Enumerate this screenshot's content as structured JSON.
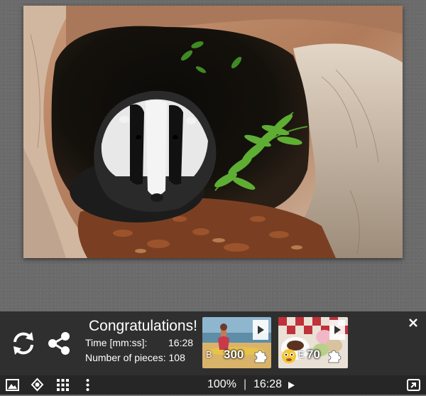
{
  "congrats": {
    "title": "Congratulations!",
    "time_label": "Time [mm:ss]:",
    "time_value": "16:28",
    "pieces_label": "Number of pieces: 108"
  },
  "next_puzzles": [
    {
      "letter": "B",
      "pieces": "300",
      "thumb_icon": "beach-woman-thumbnail"
    },
    {
      "letter": "E",
      "pieces": "70",
      "thumb_icon": "coffee-macarons-thumbnail"
    }
  ],
  "toolbar": {
    "zoom": "100%",
    "divider": "|",
    "timer": "16:28"
  },
  "icons": {
    "restart": "restart-icon",
    "share": "share-icon",
    "close": "close-icon",
    "image": "image-icon",
    "ghost": "ghost-image-icon",
    "grid": "grid-icon",
    "more": "more-vert-icon",
    "play": "play-icon",
    "fullscreen": "fullscreen-icon"
  }
}
